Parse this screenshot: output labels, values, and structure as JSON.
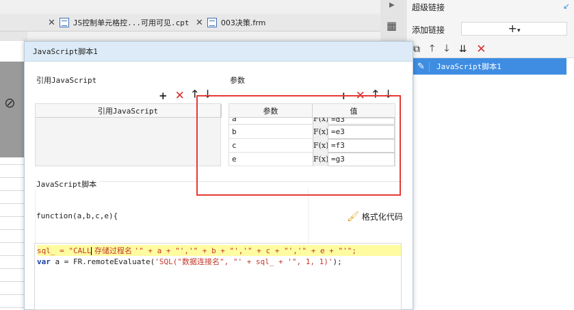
{
  "tabs": [
    {
      "label": "JS控制单元格控...可用可见.cpt"
    },
    {
      "label": "003决策.frm"
    }
  ],
  "right_panel": {
    "title": "超级链接",
    "add_label": "添加链接",
    "add_button": "+",
    "selected_item": "JavaScript脚本1"
  },
  "dialog": {
    "title": "JavaScript脚本1",
    "ref_section_label": "引用JavaScript",
    "ref_column_header": "引用JavaScript",
    "param_section_label": "参数",
    "param_headers": {
      "name": "参数",
      "value": "值"
    },
    "params": [
      {
        "name": "a",
        "fx": "F(x)",
        "value": "=d3"
      },
      {
        "name": "b",
        "fx": "F(x)",
        "value": "=e3"
      },
      {
        "name": "c",
        "fx": "F(x)",
        "value": "=f3"
      },
      {
        "name": "e",
        "fx": "F(x)",
        "value": "=g3"
      }
    ],
    "script_label": "JavaScript脚本",
    "function_signature": "function(a,b,c,e){",
    "format_button": "格式化代码",
    "code": {
      "line1_pre": "sql_ = \"CALL",
      "line1_cjk": " 存储过程名 ",
      "line1_post": "'\" + a + \"','\" + b + \"','\" + c + \"','\" + e + \"'\";",
      "line2_kw": "var",
      "line2_mid": " a = FR.remoteEvaluate(",
      "line2_str1": "'SQL(\"",
      "line2_cjk": "数据连接名",
      "line2_str2": "\", \"' + sql_ + '\", 1, 1)'",
      "line2_end": ");"
    }
  },
  "colors": {
    "highlight": "#e53935",
    "selection": "#3e8de2",
    "titlebar": "#dcebf7"
  }
}
